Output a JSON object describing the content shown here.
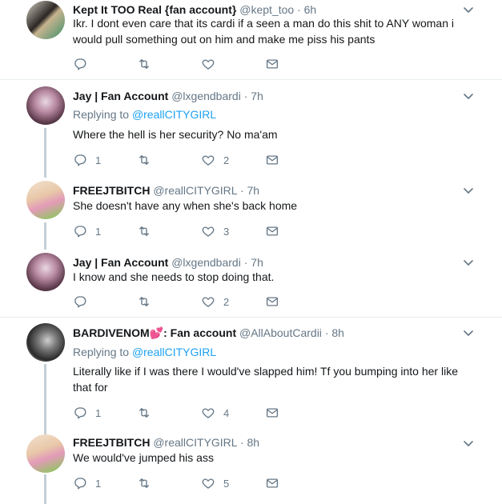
{
  "tweets": [
    {
      "name": "Kept It TOO Real {fan account}",
      "handle": "@kept_too",
      "time": "6h",
      "replying_prefix": "",
      "replying_to": "",
      "text": "Ikr. I dont even care that its cardi if a seen a man do this shit to ANY woman i would pull something out on him and make me piss his pants",
      "reply_count": "",
      "retweet_count": "",
      "like_count": ""
    },
    {
      "name": "Jay | Fan Account",
      "handle": "@lxgendbardi",
      "time": "7h",
      "replying_prefix": "Replying to",
      "replying_to": "@reallCITYGIRL",
      "text": "Where the hell is her security? No ma'am",
      "reply_count": "1",
      "retweet_count": "",
      "like_count": "2"
    },
    {
      "name": "FREEJTBITCH",
      "handle": "@reallCITYGIRL",
      "time": "7h",
      "replying_prefix": "",
      "replying_to": "",
      "text": "She doesn't have any when she's back home",
      "reply_count": "1",
      "retweet_count": "",
      "like_count": "3"
    },
    {
      "name": "Jay | Fan Account",
      "handle": "@lxgendbardi",
      "time": "7h",
      "replying_prefix": "",
      "replying_to": "",
      "text": "I know and she needs to stop doing that.",
      "reply_count": "",
      "retweet_count": "",
      "like_count": "2"
    },
    {
      "name": "BARDIVENOM💕: Fan account",
      "handle": "@AllAboutCardii",
      "time": "8h",
      "replying_prefix": "Replying to",
      "replying_to": "@reallCITYGIRL",
      "text": "Literally like if I was there I would've slapped him! Tf you bumping into her like that for",
      "reply_count": "1",
      "retweet_count": "",
      "like_count": "4"
    },
    {
      "name": "FREEJTBITCH",
      "handle": "@reallCITYGIRL",
      "time": "8h",
      "replying_prefix": "",
      "replying_to": "",
      "text": "We would've jumped his ass",
      "reply_count": "1",
      "retweet_count": "",
      "like_count": "5"
    }
  ],
  "separator": "·",
  "icons": {
    "reply": "reply-icon",
    "retweet": "retweet-icon",
    "like": "like-icon",
    "message": "direct-message-icon",
    "caret": "chevron-down-icon"
  },
  "colors": {
    "text": "#14171a",
    "muted": "#657786",
    "link": "#1da1f2",
    "divider": "#e6ecf0",
    "thread_line": "#c4cfd6"
  }
}
